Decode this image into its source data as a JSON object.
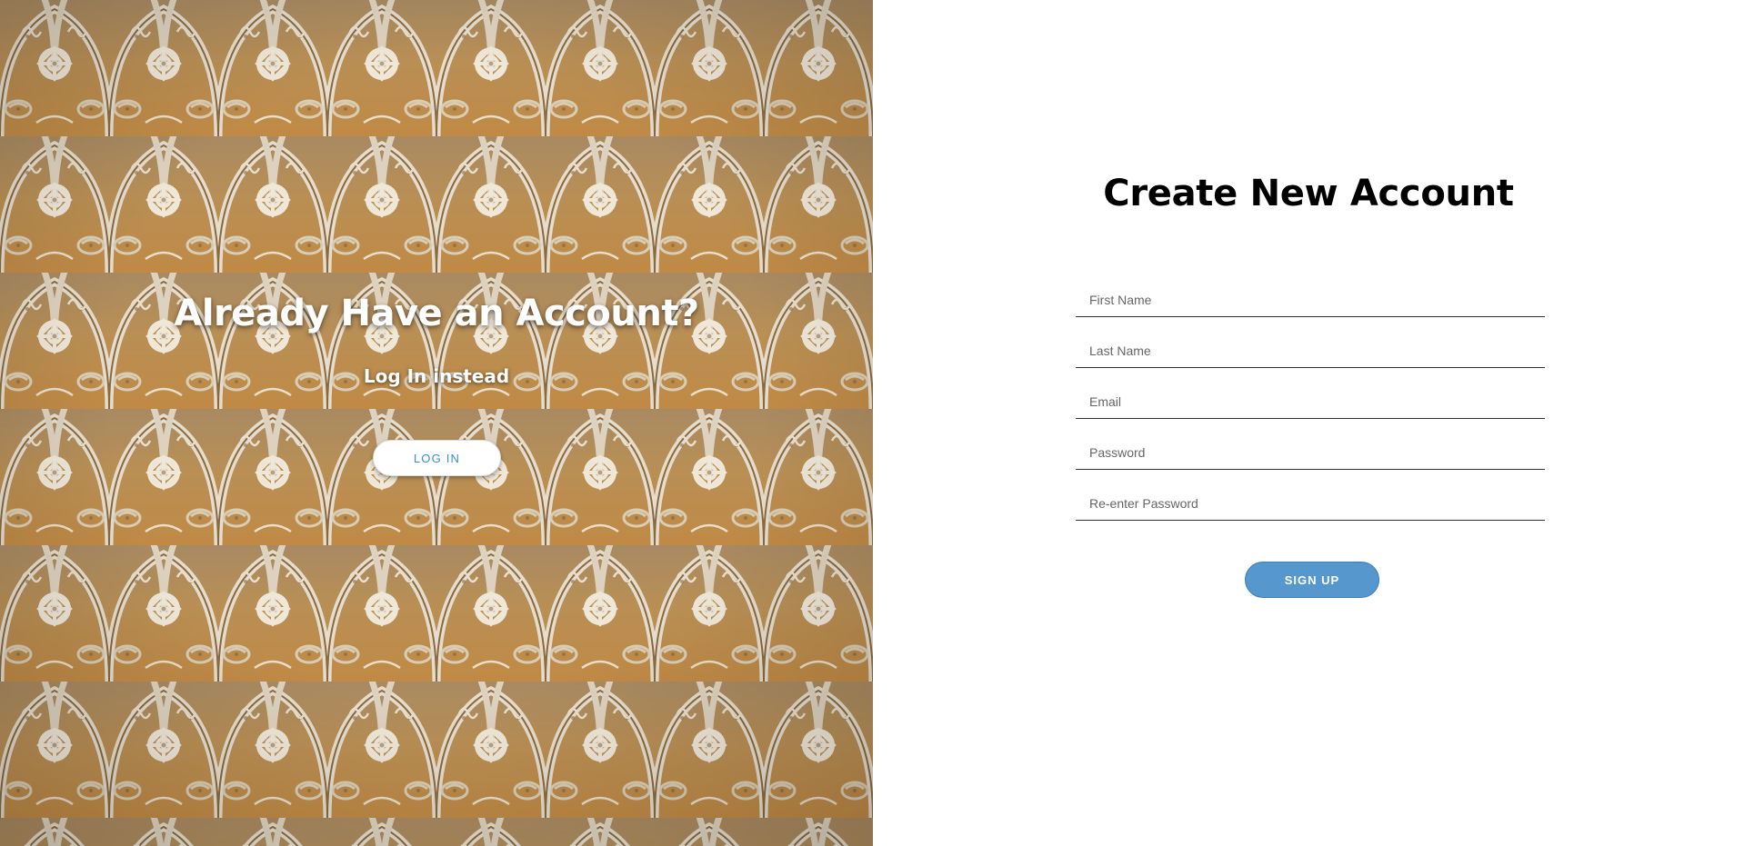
{
  "left_panel": {
    "title": "Already Have an Account?",
    "subtitle": "Log In instead",
    "login_button_label": "LOG IN"
  },
  "right_panel": {
    "title": "Create New Account",
    "fields": [
      {
        "placeholder": "First Name",
        "value": ""
      },
      {
        "placeholder": "Last Name",
        "value": ""
      },
      {
        "placeholder": "Email",
        "value": ""
      },
      {
        "placeholder": "Password",
        "value": ""
      },
      {
        "placeholder": "Re-enter Password",
        "value": ""
      }
    ],
    "signup_button_label": "SIGN UP"
  },
  "colors": {
    "accent_blue": "#5697cd",
    "login_text_blue": "#3b8fc6",
    "background_tan": "#b08a55"
  }
}
